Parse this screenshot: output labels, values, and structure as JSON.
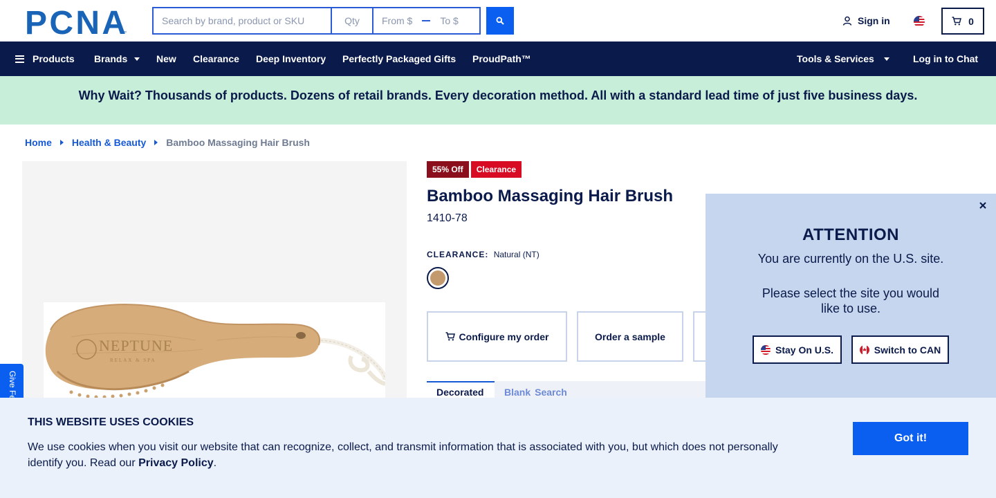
{
  "header": {
    "logo_text": "PCNA",
    "search_placeholder": "Search by brand, product or SKU",
    "qty_placeholder": "Qty",
    "price_from_placeholder": "From $",
    "price_to_placeholder": "To $",
    "sign_in_label": "Sign in",
    "cart_count": "0"
  },
  "nav": {
    "items": [
      {
        "label": "Products"
      },
      {
        "label": "Brands"
      },
      {
        "label": "New"
      },
      {
        "label": "Clearance"
      },
      {
        "label": "Deep Inventory"
      },
      {
        "label": "Perfectly Packaged Gifts"
      },
      {
        "label": "ProudPath™"
      }
    ],
    "tools_label": "Tools & Services",
    "chat_label": "Log in to Chat"
  },
  "promo": {
    "text": "Why Wait? Thousands of products. Dozens of retail brands. Every decoration method. All with a standard lead time of just five business days."
  },
  "breadcrumb": {
    "items": [
      {
        "label": "Home"
      },
      {
        "label": "Health & Beauty"
      },
      {
        "label": "Bamboo Massaging Hair Brush"
      }
    ]
  },
  "product": {
    "badge_discount": "55% Off",
    "badge_clearance": "Clearance",
    "title": "Bamboo Massaging Hair Brush",
    "sku": "1410-78",
    "color_heading": "CLEARANCE:",
    "color_value": "Natural (NT)",
    "image_brand_text": "NEPTUNE",
    "image_brand_subtext": "RELAX & SPA",
    "actions": {
      "configure_label": "Configure my order",
      "sample_label": "Order a sample"
    },
    "tabs": [
      {
        "label": "Decorated"
      },
      {
        "label": "Blank"
      },
      {
        "label": "Search"
      }
    ]
  },
  "feedback": {
    "label": "Give Feedback"
  },
  "attention": {
    "title": "ATTENTION",
    "line1": "You are currently on the U.S. site.",
    "line2": "Please select the site you would like to use.",
    "stay_label": "Stay On U.S.",
    "switch_label": "Switch to CAN"
  },
  "cookies": {
    "title": "THIS WEBSITE USES COOKIES",
    "text": "We use cookies when you visit our website that can recognize, collect, and transmit information that is associated with you, but which does not personally identify you. Read our",
    "policy_link": "Privacy Policy",
    "period": ".",
    "button_label": "Got it!"
  },
  "colors": {
    "navy": "#0a1a4a",
    "brand_blue": "#0a5ef0",
    "promo_green": "#c6eed8",
    "badge_red": "#d70c24",
    "badge_dark_red": "#8a0e1c",
    "popup_blue": "#c5d6ee",
    "cookie_bg": "#eaf1fb",
    "swatch_natural": "#c29a6e"
  }
}
